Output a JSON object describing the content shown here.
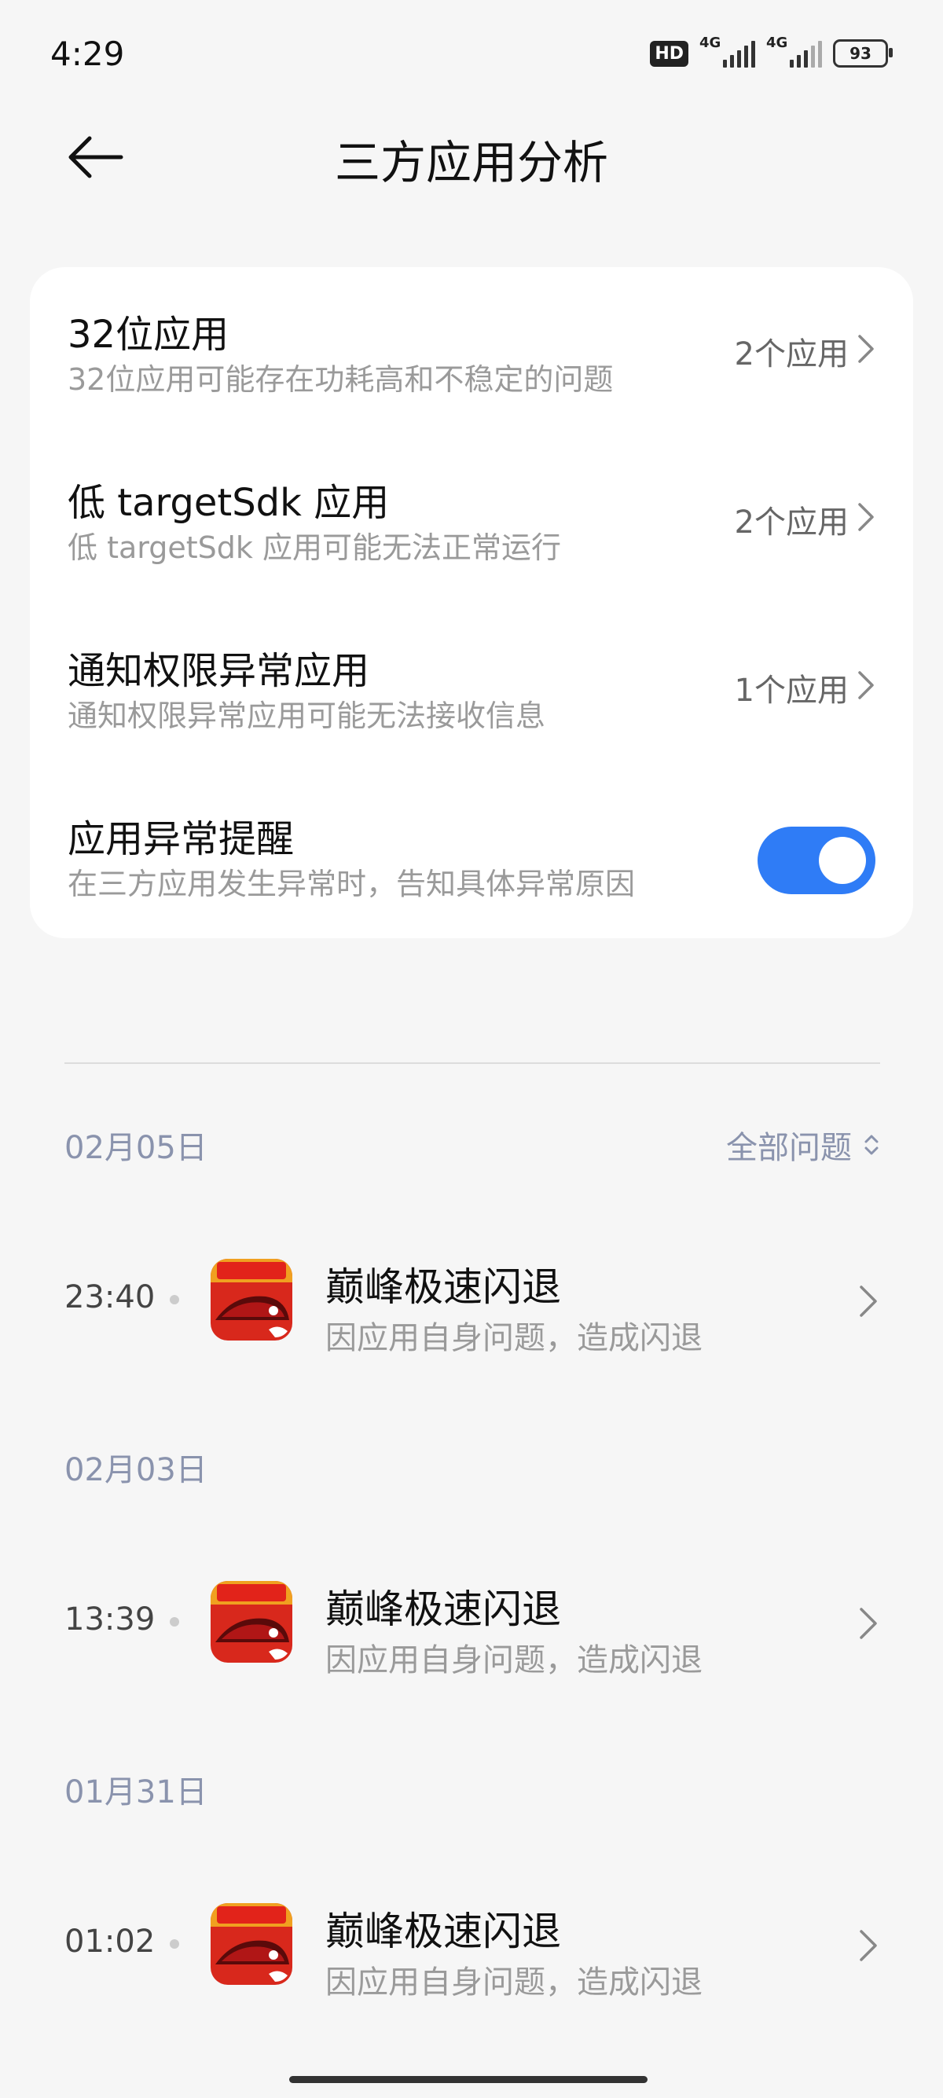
{
  "status_bar": {
    "time": "4:29",
    "hd_badge": "HD",
    "signal1_label": "4G",
    "signal2_label": "4G",
    "battery": "93"
  },
  "header": {
    "title": "三方应用分析",
    "back_icon": "arrow-left-icon"
  },
  "settings": [
    {
      "title": "32位应用",
      "subtitle": "32位应用可能存在功耗高和不稳定的问题",
      "value": "2个应用"
    },
    {
      "title": "低 targetSdk 应用",
      "subtitle": "低 targetSdk 应用可能无法正常运行",
      "value": "2个应用"
    },
    {
      "title": "通知权限异常应用",
      "subtitle": "通知权限异常应用可能无法接收信息",
      "value": "1个应用"
    },
    {
      "title": "应用异常提醒",
      "subtitle": "在三方应用发生异常时，告知具体异常原因",
      "toggle_on": true
    }
  ],
  "filter_label": "全部问题",
  "groups": [
    {
      "date": "02月05日",
      "time": "23:40",
      "app": "巅峰极速闪退",
      "reason": "因应用自身问题，造成闪退"
    },
    {
      "date": "02月03日",
      "time": "13:39",
      "app": "巅峰极速闪退",
      "reason": "因应用自身问题，造成闪退"
    },
    {
      "date": "01月31日",
      "time": "01:02",
      "app": "巅峰极速闪退",
      "reason": "因应用自身问题，造成闪退"
    }
  ],
  "colors": {
    "accent": "#2f7cf6",
    "date_label": "#8a93ad",
    "background": "#f6f6f6"
  }
}
